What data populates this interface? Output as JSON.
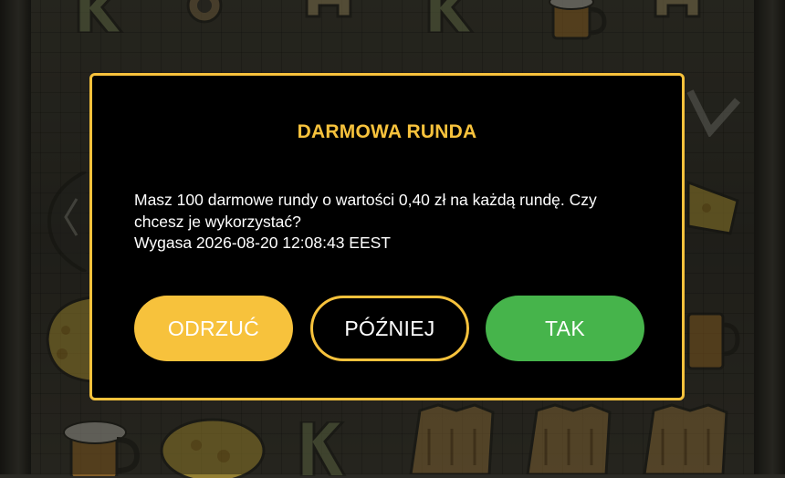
{
  "dialog": {
    "title": "DARMOWA RUNDA",
    "message": "Masz 100 darmowe rundy o wartości 0,40 zł na każdą rundę. Czy chcesz je wykorzystać?",
    "expiry": "Wygasa 2026-08-20 12:08:43 EEST",
    "buttons": {
      "decline": "ODRZUĆ",
      "later": "PÓŹNIEJ",
      "accept": "TAK"
    }
  },
  "background": {
    "symbols": [
      "beer-mug-icon",
      "cheese-icon",
      "baguette-icon",
      "letter-k-icon",
      "letter-q-icon",
      "letter-a-icon",
      "helmet-icon"
    ]
  },
  "colors": {
    "accent": "#f7c23c",
    "accept": "#46b44b",
    "modal_bg": "#000000",
    "text": "#ffffff"
  }
}
